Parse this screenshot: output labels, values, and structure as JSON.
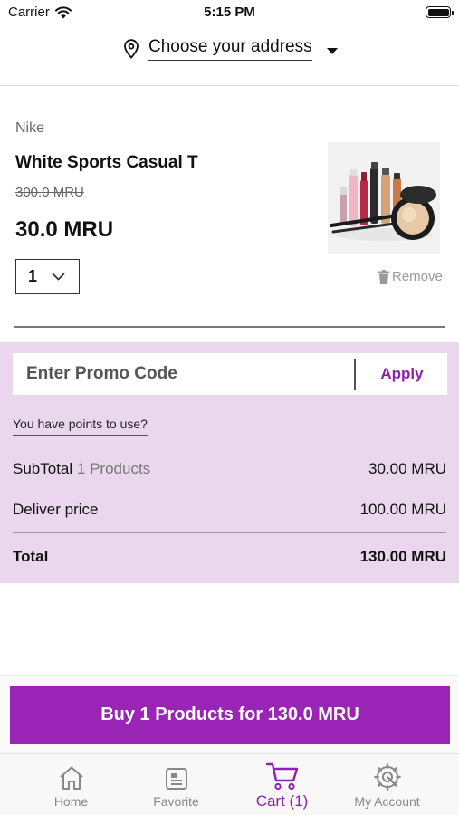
{
  "status_bar": {
    "carrier": "Carrier",
    "time": "5:15 PM"
  },
  "address": {
    "label": "Choose your address"
  },
  "product": {
    "brand": "Nike",
    "name": "White Sports Casual T",
    "old_price": "300.0 MRU",
    "price": "30.0 MRU",
    "quantity": "1",
    "remove_label": "Remove",
    "image_icon": "cosmetics-product-image"
  },
  "promo": {
    "placeholder": "Enter Promo Code",
    "apply_label": "Apply"
  },
  "points_link": "You have points to use?",
  "summary": {
    "subtotal_label": "SubTotal",
    "subtotal_count": "1 Products",
    "subtotal_value": "30.00 MRU",
    "delivery_label": "Deliver price",
    "delivery_value": "100.00 MRU",
    "total_label": "Total",
    "total_value": "130.00 MRU"
  },
  "buy_button": {
    "label": "Buy 1 Products for 130.0 MRU"
  },
  "tabs": [
    {
      "label": "Home",
      "icon": "home-icon"
    },
    {
      "label": "Favorite",
      "icon": "favorite-icon"
    },
    {
      "label": "Cart (1)",
      "icon": "cart-icon",
      "active": true
    },
    {
      "label": "My Account",
      "icon": "gear-icon"
    }
  ],
  "colors": {
    "accent": "#9924b5",
    "panel": "#ead7ee"
  }
}
